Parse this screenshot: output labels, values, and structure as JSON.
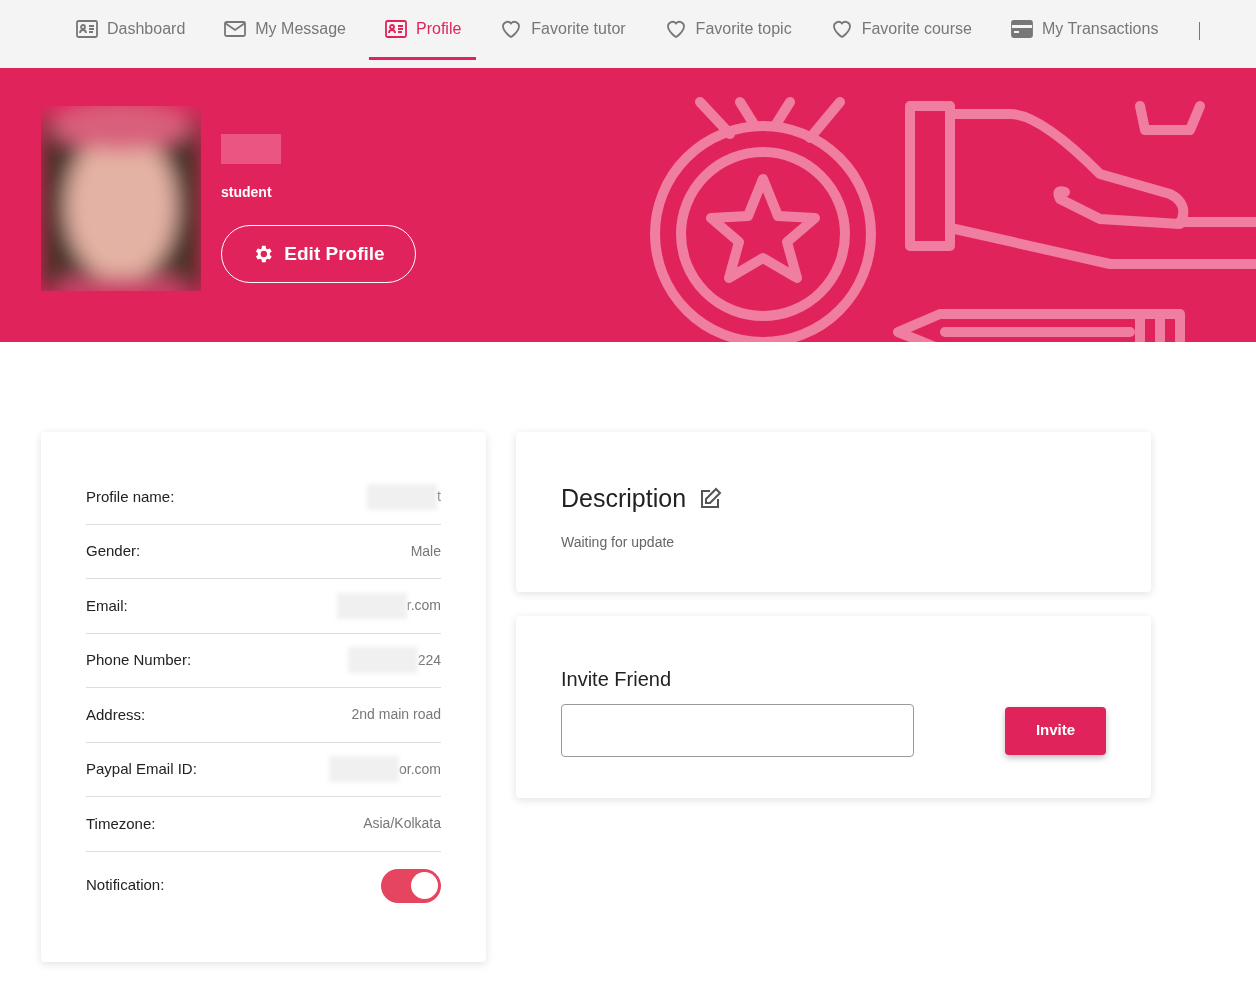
{
  "nav": [
    {
      "label": "Dashboard",
      "kind": "card",
      "selected": false
    },
    {
      "label": "My Message",
      "kind": "mail",
      "selected": false
    },
    {
      "label": "Profile",
      "kind": "card",
      "selected": true
    },
    {
      "label": "Favorite tutor",
      "kind": "heart",
      "selected": false
    },
    {
      "label": "Favorite topic",
      "kind": "heart",
      "selected": false
    },
    {
      "label": "Favorite course",
      "kind": "heart",
      "selected": false
    },
    {
      "label": "My Transactions",
      "kind": "wallet",
      "selected": false
    }
  ],
  "banner": {
    "role": "student",
    "edit_button": "Edit Profile"
  },
  "details": [
    {
      "kind": "text",
      "label": "Profile name:",
      "value": "t",
      "blurred": true
    },
    {
      "kind": "text",
      "label": "Gender:",
      "value": "Male",
      "blurred": false
    },
    {
      "kind": "text",
      "label": "Email:",
      "value": "r.com",
      "blurred": true
    },
    {
      "kind": "text",
      "label": "Phone Number:",
      "value": "224",
      "blurred": true
    },
    {
      "kind": "text",
      "label": "Address:",
      "value": "2nd main road",
      "blurred": false
    },
    {
      "kind": "text",
      "label": "Paypal Email ID:",
      "value": "or.com",
      "blurred": true
    },
    {
      "kind": "text",
      "label": "Timezone:",
      "value": "Asia/Kolkata",
      "blurred": false
    },
    {
      "kind": "toggle",
      "label": "Notification:",
      "on": true
    }
  ],
  "description": {
    "title": "Description",
    "text": "Waiting for update"
  },
  "invite": {
    "title": "Invite Friend",
    "button": "Invite"
  }
}
